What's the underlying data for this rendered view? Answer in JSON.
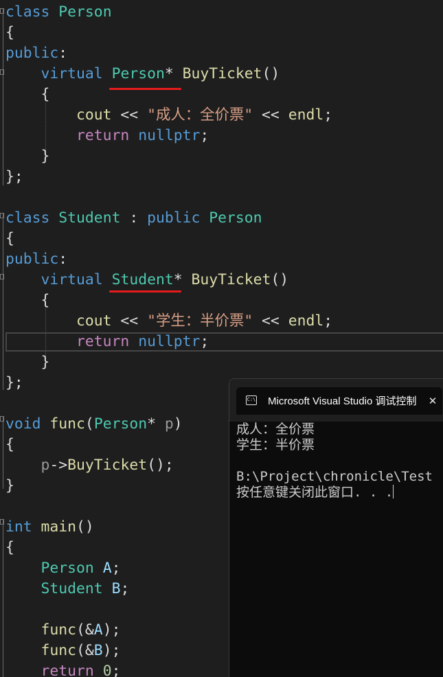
{
  "editor": {
    "lines": [
      [
        {
          "c": "k",
          "t": "class"
        },
        {
          "c": "d",
          "t": " "
        },
        {
          "c": "t",
          "t": "Person"
        }
      ],
      [
        {
          "c": "d",
          "t": "{"
        }
      ],
      [
        {
          "c": "k",
          "t": "public"
        },
        {
          "c": "d",
          "t": ":"
        }
      ],
      [
        {
          "c": "d",
          "t": "    "
        },
        {
          "c": "k",
          "t": "virtual"
        },
        {
          "c": "d",
          "t": " "
        },
        {
          "c": "t",
          "t": "Person"
        },
        {
          "c": "d",
          "t": "* "
        },
        {
          "c": "f",
          "t": "BuyTicket"
        },
        {
          "c": "d",
          "t": "()"
        }
      ],
      [
        {
          "c": "d",
          "t": "    {"
        }
      ],
      [
        {
          "c": "d",
          "t": "        "
        },
        {
          "c": "f",
          "t": "cout"
        },
        {
          "c": "d",
          "t": " << "
        },
        {
          "c": "s",
          "t": "\"成人：全价票\""
        },
        {
          "c": "d",
          "t": " << "
        },
        {
          "c": "f",
          "t": "endl"
        },
        {
          "c": "d",
          "t": ";"
        }
      ],
      [
        {
          "c": "d",
          "t": "        "
        },
        {
          "c": "c",
          "t": "return"
        },
        {
          "c": "d",
          "t": " "
        },
        {
          "c": "k",
          "t": "nullptr"
        },
        {
          "c": "d",
          "t": ";"
        }
      ],
      [
        {
          "c": "d",
          "t": "    }"
        }
      ],
      [
        {
          "c": "d",
          "t": "};"
        }
      ],
      [],
      [
        {
          "c": "k",
          "t": "class"
        },
        {
          "c": "d",
          "t": " "
        },
        {
          "c": "t",
          "t": "Student"
        },
        {
          "c": "d",
          "t": " : "
        },
        {
          "c": "k",
          "t": "public"
        },
        {
          "c": "d",
          "t": " "
        },
        {
          "c": "t",
          "t": "Person"
        }
      ],
      [
        {
          "c": "d",
          "t": "{"
        }
      ],
      [
        {
          "c": "k",
          "t": "public"
        },
        {
          "c": "d",
          "t": ":"
        }
      ],
      [
        {
          "c": "d",
          "t": "    "
        },
        {
          "c": "k",
          "t": "virtual"
        },
        {
          "c": "d",
          "t": " "
        },
        {
          "c": "t",
          "t": "Student"
        },
        {
          "c": "d",
          "t": "* "
        },
        {
          "c": "f",
          "t": "BuyTicket"
        },
        {
          "c": "d",
          "t": "()"
        }
      ],
      [
        {
          "c": "d",
          "t": "    {"
        }
      ],
      [
        {
          "c": "d",
          "t": "        "
        },
        {
          "c": "f",
          "t": "cout"
        },
        {
          "c": "d",
          "t": " << "
        },
        {
          "c": "s",
          "t": "\"学生：半价票\""
        },
        {
          "c": "d",
          "t": " << "
        },
        {
          "c": "f",
          "t": "endl"
        },
        {
          "c": "d",
          "t": ";"
        }
      ],
      [
        {
          "c": "d",
          "t": "        "
        },
        {
          "c": "c",
          "t": "return"
        },
        {
          "c": "d",
          "t": " "
        },
        {
          "c": "k",
          "t": "nullptr"
        },
        {
          "c": "d",
          "t": ";"
        }
      ],
      [
        {
          "c": "d",
          "t": "    }"
        }
      ],
      [
        {
          "c": "d",
          "t": "};"
        }
      ],
      [],
      [
        {
          "c": "k",
          "t": "void"
        },
        {
          "c": "d",
          "t": " "
        },
        {
          "c": "f",
          "t": "func"
        },
        {
          "c": "d",
          "t": "("
        },
        {
          "c": "t",
          "t": "Person"
        },
        {
          "c": "d",
          "t": "* "
        },
        {
          "c": "p",
          "t": "p"
        },
        {
          "c": "d",
          "t": ")"
        }
      ],
      [
        {
          "c": "d",
          "t": "{"
        }
      ],
      [
        {
          "c": "d",
          "t": "    "
        },
        {
          "c": "p",
          "t": "p"
        },
        {
          "c": "d",
          "t": "->"
        },
        {
          "c": "f",
          "t": "BuyTicket"
        },
        {
          "c": "d",
          "t": "();"
        }
      ],
      [
        {
          "c": "d",
          "t": "}"
        }
      ],
      [],
      [
        {
          "c": "k",
          "t": "int"
        },
        {
          "c": "d",
          "t": " "
        },
        {
          "c": "f",
          "t": "main"
        },
        {
          "c": "d",
          "t": "()"
        }
      ],
      [
        {
          "c": "d",
          "t": "{"
        }
      ],
      [
        {
          "c": "d",
          "t": "    "
        },
        {
          "c": "t",
          "t": "Person"
        },
        {
          "c": "d",
          "t": " "
        },
        {
          "c": "v",
          "t": "A"
        },
        {
          "c": "d",
          "t": ";"
        }
      ],
      [
        {
          "c": "d",
          "t": "    "
        },
        {
          "c": "t",
          "t": "Student"
        },
        {
          "c": "d",
          "t": " "
        },
        {
          "c": "v",
          "t": "B"
        },
        {
          "c": "d",
          "t": ";"
        }
      ],
      [],
      [
        {
          "c": "d",
          "t": "    "
        },
        {
          "c": "f",
          "t": "func"
        },
        {
          "c": "d",
          "t": "(&"
        },
        {
          "c": "v",
          "t": "A"
        },
        {
          "c": "d",
          "t": ");"
        }
      ],
      [
        {
          "c": "d",
          "t": "    "
        },
        {
          "c": "f",
          "t": "func"
        },
        {
          "c": "d",
          "t": "(&"
        },
        {
          "c": "v",
          "t": "B"
        },
        {
          "c": "d",
          "t": ");"
        }
      ],
      [
        {
          "c": "d",
          "t": "    "
        },
        {
          "c": "c",
          "t": "return"
        },
        {
          "c": "d",
          "t": " "
        },
        {
          "c": "n",
          "t": "0"
        },
        {
          "c": "d",
          "t": ";"
        }
      ]
    ],
    "current_line_index": 16
  },
  "console": {
    "icon": "console-window-icon",
    "icon_glyph": "C:\\",
    "title": "Microsoft Visual Studio 调试控制台",
    "close_label": "✕",
    "output": [
      "成人：全价票",
      "学生：半价票",
      "",
      "B:\\Project\\chronicle\\Test",
      "按任意键关闭此窗口. . ."
    ]
  },
  "colors": {
    "editor_background": "#1e1e1e",
    "keyword": "#569cd6",
    "type": "#4ec9b0",
    "function": "#dcdcaa",
    "string": "#d69d85",
    "control": "#c586c0",
    "variable": "#9cdcfe",
    "number": "#b5cea8",
    "annotation_underline": "#e51c1c",
    "console_background": "#0c0c0c"
  }
}
